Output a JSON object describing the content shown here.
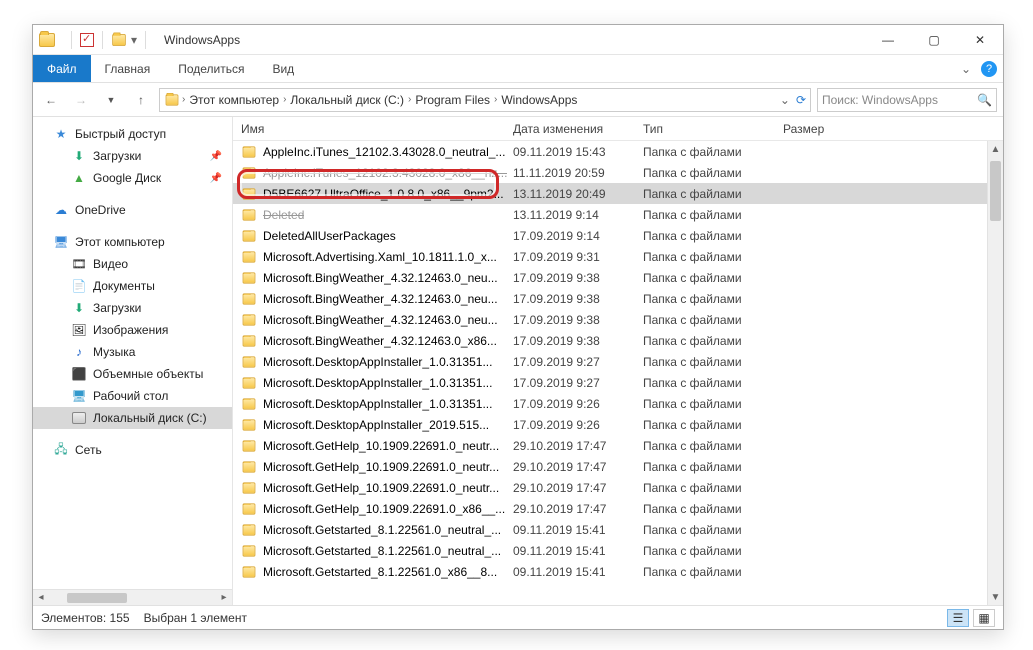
{
  "titlebar": {
    "title": "WindowsApps"
  },
  "ribbon": {
    "tabs": [
      "Файл",
      "Главная",
      "Поделиться",
      "Вид"
    ],
    "active": 0
  },
  "breadcrumbs": [
    "Этот компьютер",
    "Локальный диск (C:)",
    "Program Files",
    "WindowsApps"
  ],
  "search": {
    "placeholder": "Поиск: WindowsApps"
  },
  "columns": {
    "name": "Имя",
    "date": "Дата изменения",
    "type": "Тип",
    "size": "Размер"
  },
  "sidebar": {
    "quick": {
      "label": "Быстрый доступ",
      "items": [
        {
          "label": "Загрузки",
          "icon": "download",
          "pin": true
        },
        {
          "label": "Google Диск",
          "icon": "gdrive",
          "pin": true
        }
      ]
    },
    "onedrive": {
      "label": "OneDrive"
    },
    "thispc": {
      "label": "Этот компьютер",
      "items": [
        {
          "label": "Видео",
          "icon": "video"
        },
        {
          "label": "Документы",
          "icon": "docs"
        },
        {
          "label": "Загрузки",
          "icon": "download"
        },
        {
          "label": "Изображения",
          "icon": "images"
        },
        {
          "label": "Музыка",
          "icon": "music"
        },
        {
          "label": "Объемные объекты",
          "icon": "3d"
        },
        {
          "label": "Рабочий стол",
          "icon": "desktop"
        },
        {
          "label": "Локальный диск (C:)",
          "icon": "disk",
          "selected": true
        }
      ]
    },
    "network": {
      "label": "Сеть"
    }
  },
  "files": [
    {
      "name": "AppleInc.iTunes_12102.3.43028.0_neutral_...",
      "date": "09.11.2019 15:43",
      "type": "Папка с файлами"
    },
    {
      "name": "AppleInc.iTunes_12102.3.43028.0_x86__nz...",
      "date": "11.11.2019 20:59",
      "type": "Папка с файлами",
      "struck": true
    },
    {
      "name": "D5BE6627.UltraOffice_1.0.8.0_x86__9pm2...",
      "date": "13.11.2019 20:49",
      "type": "Папка с файлами",
      "selected": true,
      "highlighted": true
    },
    {
      "name": "Deleted",
      "date": "13.11.2019 9:14",
      "type": "Папка с файлами",
      "struck": true
    },
    {
      "name": "DeletedAllUserPackages",
      "date": "17.09.2019 9:14",
      "type": "Папка с файлами"
    },
    {
      "name": "Microsoft.Advertising.Xaml_10.1811.1.0_x...",
      "date": "17.09.2019 9:31",
      "type": "Папка с файлами"
    },
    {
      "name": "Microsoft.BingWeather_4.32.12463.0_neu...",
      "date": "17.09.2019 9:38",
      "type": "Папка с файлами"
    },
    {
      "name": "Microsoft.BingWeather_4.32.12463.0_neu...",
      "date": "17.09.2019 9:38",
      "type": "Папка с файлами"
    },
    {
      "name": "Microsoft.BingWeather_4.32.12463.0_neu...",
      "date": "17.09.2019 9:38",
      "type": "Папка с файлами"
    },
    {
      "name": "Microsoft.BingWeather_4.32.12463.0_x86...",
      "date": "17.09.2019 9:38",
      "type": "Папка с файлами"
    },
    {
      "name": "Microsoft.DesktopAppInstaller_1.0.31351...",
      "date": "17.09.2019 9:27",
      "type": "Папка с файлами"
    },
    {
      "name": "Microsoft.DesktopAppInstaller_1.0.31351...",
      "date": "17.09.2019 9:27",
      "type": "Папка с файлами"
    },
    {
      "name": "Microsoft.DesktopAppInstaller_1.0.31351...",
      "date": "17.09.2019 9:26",
      "type": "Папка с файлами"
    },
    {
      "name": "Microsoft.DesktopAppInstaller_2019.515...",
      "date": "17.09.2019 9:26",
      "type": "Папка с файлами"
    },
    {
      "name": "Microsoft.GetHelp_10.1909.22691.0_neutr...",
      "date": "29.10.2019 17:47",
      "type": "Папка с файлами"
    },
    {
      "name": "Microsoft.GetHelp_10.1909.22691.0_neutr...",
      "date": "29.10.2019 17:47",
      "type": "Папка с файлами"
    },
    {
      "name": "Microsoft.GetHelp_10.1909.22691.0_neutr...",
      "date": "29.10.2019 17:47",
      "type": "Папка с файлами"
    },
    {
      "name": "Microsoft.GetHelp_10.1909.22691.0_x86__...",
      "date": "29.10.2019 17:47",
      "type": "Папка с файлами"
    },
    {
      "name": "Microsoft.Getstarted_8.1.22561.0_neutral_...",
      "date": "09.11.2019 15:41",
      "type": "Папка с файлами"
    },
    {
      "name": "Microsoft.Getstarted_8.1.22561.0_neutral_...",
      "date": "09.11.2019 15:41",
      "type": "Папка с файлами"
    },
    {
      "name": "Microsoft.Getstarted_8.1.22561.0_x86__8...",
      "date": "09.11.2019 15:41",
      "type": "Папка с файлами"
    }
  ],
  "status": {
    "items": "Элементов: 155",
    "selected": "Выбран 1 элемент"
  }
}
